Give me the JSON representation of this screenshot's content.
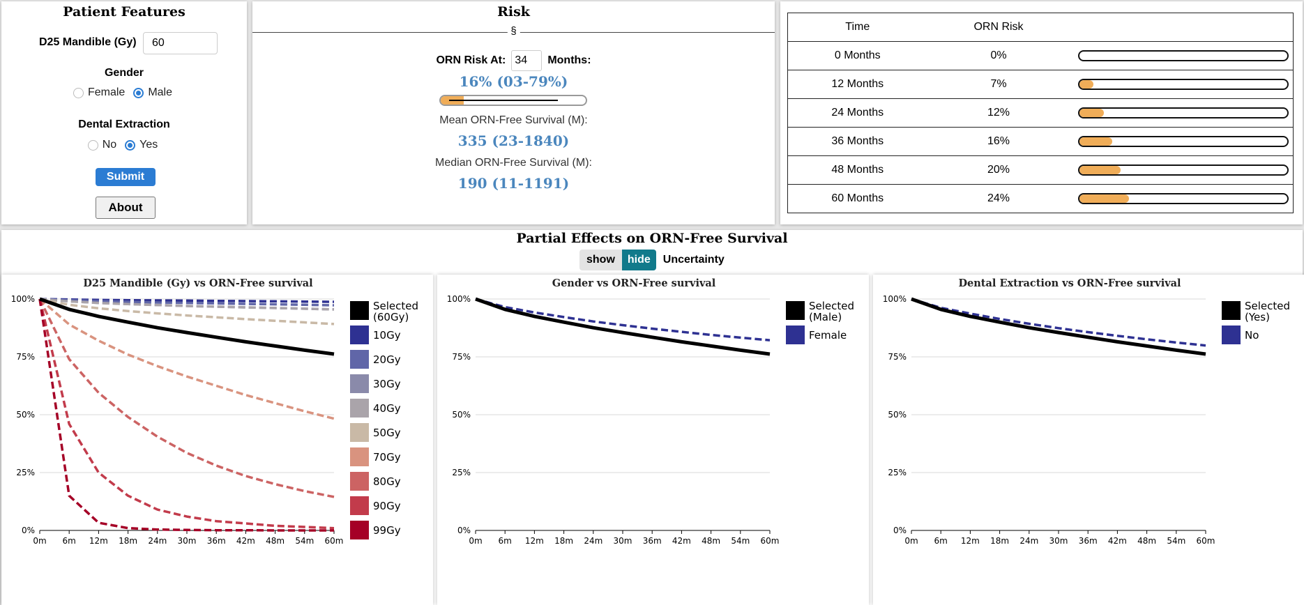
{
  "patient_features": {
    "title": "Patient Features",
    "d25_label": "D25 Mandible (Gy)",
    "d25_value": "60",
    "gender_label": "Gender",
    "gender_options": [
      "Female",
      "Male"
    ],
    "gender_selected": "Male",
    "dental_label": "Dental Extraction",
    "dental_options": [
      "No",
      "Yes"
    ],
    "dental_selected": "Yes",
    "submit_label": "Submit",
    "about_label": "About"
  },
  "risk": {
    "title": "Risk",
    "divider_symbol": "§",
    "risk_at_label": "ORN Risk At:",
    "risk_at_value": "34",
    "months_label": "Months:",
    "risk_value": "16% (03-79%)",
    "risk_fraction": 0.16,
    "mean_label": "Mean ORN-Free Survival (M):",
    "mean_value": "335 (23-1840)",
    "median_label": "Median ORN-Free Survival (M):",
    "median_value": "190 (11-1191)"
  },
  "risk_table": {
    "headers": [
      "Time",
      "ORN Risk"
    ],
    "rows": [
      {
        "time": "0 Months",
        "risk": "0%",
        "fraction": 0.0
      },
      {
        "time": "12 Months",
        "risk": "7%",
        "fraction": 0.07
      },
      {
        "time": "24 Months",
        "risk": "12%",
        "fraction": 0.12
      },
      {
        "time": "36 Months",
        "risk": "16%",
        "fraction": 0.16
      },
      {
        "time": "48 Months",
        "risk": "20%",
        "fraction": 0.2
      },
      {
        "time": "60 Months",
        "risk": "24%",
        "fraction": 0.24
      }
    ],
    "bar_color": "#f0ad58"
  },
  "partial_effects": {
    "title": "Partial Effects on ORN-Free Survival",
    "show_label": "show",
    "hide_label": "hide",
    "uncertainty_label": "Uncertainty",
    "accent": "#117a8b"
  },
  "chart_data": [
    {
      "type": "line",
      "title": "D25 Mandible (Gy) vs ORN-Free survival",
      "x": [
        "0m",
        "6m",
        "12m",
        "18m",
        "24m",
        "30m",
        "36m",
        "42m",
        "48m",
        "54m",
        "60m"
      ],
      "y_ticks": [
        "100%",
        "75%",
        "50%",
        "25%",
        "0%"
      ],
      "ylim": [
        0,
        1
      ],
      "series": [
        {
          "name": "Selected (60Gy)",
          "color": "#000000",
          "dashed": false,
          "values": [
            1.0,
            0.955,
            0.925,
            0.9,
            0.876,
            0.855,
            0.835,
            0.815,
            0.797,
            0.779,
            0.762
          ]
        },
        {
          "name": "10Gy",
          "color": "#2e3192",
          "dashed": true,
          "values": [
            1.0,
            0.998,
            0.996,
            0.995,
            0.994,
            0.993,
            0.992,
            0.991,
            0.99,
            0.989,
            0.988
          ]
        },
        {
          "name": "20Gy",
          "color": "#6066a8",
          "dashed": true,
          "values": [
            1.0,
            0.995,
            0.991,
            0.988,
            0.985,
            0.983,
            0.981,
            0.979,
            0.977,
            0.975,
            0.973
          ]
        },
        {
          "name": "30Gy",
          "color": "#8a8aaa",
          "dashed": true,
          "values": [
            1.0,
            0.99,
            0.983,
            0.978,
            0.974,
            0.97,
            0.967,
            0.964,
            0.961,
            0.958,
            0.955
          ]
        },
        {
          "name": "40Gy",
          "color": "#aaa4aa",
          "dashed": true,
          "values": [
            1.0,
            0.99,
            0.983,
            0.978,
            0.974,
            0.97,
            0.967,
            0.964,
            0.961,
            0.958,
            0.955
          ]
        },
        {
          "name": "50Gy",
          "color": "#c9b9a6",
          "dashed": true,
          "values": [
            1.0,
            0.975,
            0.96,
            0.948,
            0.938,
            0.929,
            0.921,
            0.913,
            0.906,
            0.899,
            0.892
          ]
        },
        {
          "name": "70Gy",
          "color": "#d9937f",
          "dashed": true,
          "values": [
            1.0,
            0.89,
            0.82,
            0.76,
            0.71,
            0.665,
            0.625,
            0.585,
            0.55,
            0.515,
            0.483
          ]
        },
        {
          "name": "80Gy",
          "color": "#cc6363",
          "dashed": true,
          "values": [
            1.0,
            0.74,
            0.595,
            0.49,
            0.405,
            0.335,
            0.28,
            0.235,
            0.2,
            0.17,
            0.145
          ]
        },
        {
          "name": "90Gy",
          "color": "#c23b4b",
          "dashed": true,
          "values": [
            1.0,
            0.46,
            0.25,
            0.15,
            0.09,
            0.06,
            0.04,
            0.03,
            0.02,
            0.015,
            0.01
          ]
        },
        {
          "name": "99Gy",
          "color": "#a50026",
          "dashed": true,
          "values": [
            1.0,
            0.15,
            0.033,
            0.01,
            0.004,
            0.002,
            0.001,
            0.001,
            0.0,
            0.0,
            0.0
          ]
        }
      ]
    },
    {
      "type": "line",
      "title": "Gender vs ORN-Free survival",
      "x": [
        "0m",
        "6m",
        "12m",
        "18m",
        "24m",
        "30m",
        "36m",
        "42m",
        "48m",
        "54m",
        "60m"
      ],
      "y_ticks": [
        "100%",
        "75%",
        "50%",
        "25%",
        "0%"
      ],
      "ylim": [
        0,
        1
      ],
      "series": [
        {
          "name": "Selected (Male)",
          "color": "#000000",
          "dashed": false,
          "values": [
            1.0,
            0.955,
            0.925,
            0.9,
            0.876,
            0.855,
            0.835,
            0.815,
            0.797,
            0.779,
            0.762
          ]
        },
        {
          "name": "Female",
          "color": "#2e3192",
          "dashed": true,
          "values": [
            1.0,
            0.965,
            0.942,
            0.922,
            0.903,
            0.887,
            0.872,
            0.858,
            0.845,
            0.833,
            0.822
          ]
        }
      ]
    },
    {
      "type": "line",
      "title": "Dental Extraction vs ORN-Free survival",
      "x": [
        "0m",
        "6m",
        "12m",
        "18m",
        "24m",
        "30m",
        "36m",
        "42m",
        "48m",
        "54m",
        "60m"
      ],
      "y_ticks": [
        "100%",
        "75%",
        "50%",
        "25%",
        "0%"
      ],
      "ylim": [
        0,
        1
      ],
      "series": [
        {
          "name": "Selected (Yes)",
          "color": "#000000",
          "dashed": false,
          "values": [
            1.0,
            0.955,
            0.925,
            0.9,
            0.876,
            0.855,
            0.835,
            0.815,
            0.797,
            0.779,
            0.762
          ]
        },
        {
          "name": "No",
          "color": "#2e3192",
          "dashed": true,
          "values": [
            1.0,
            0.962,
            0.937,
            0.914,
            0.893,
            0.874,
            0.857,
            0.841,
            0.826,
            0.812,
            0.799
          ]
        }
      ]
    }
  ]
}
